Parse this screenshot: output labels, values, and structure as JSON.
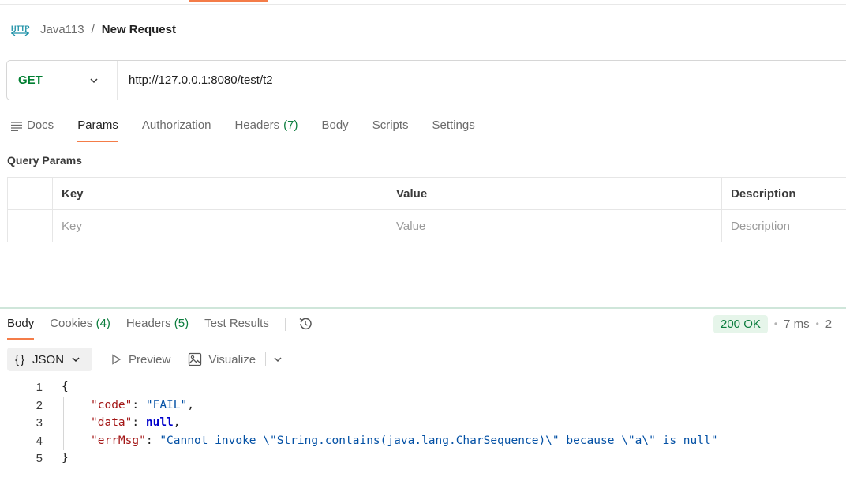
{
  "breadcrumb": {
    "icon": "http-icon",
    "collection": "Java113",
    "separator": "/",
    "title": "New Request"
  },
  "request": {
    "method": "GET",
    "url": "http://127.0.0.1:8080/test/t2"
  },
  "request_tabs": [
    {
      "label": "Docs",
      "count": ""
    },
    {
      "label": "Params",
      "count": ""
    },
    {
      "label": "Authorization",
      "count": ""
    },
    {
      "label": "Headers",
      "count": "(7)"
    },
    {
      "label": "Body",
      "count": ""
    },
    {
      "label": "Scripts",
      "count": ""
    },
    {
      "label": "Settings",
      "count": ""
    }
  ],
  "query_params": {
    "title": "Query Params",
    "columns": [
      "Key",
      "Value",
      "Description"
    ],
    "placeholders": [
      "Key",
      "Value",
      "Description"
    ]
  },
  "response_tabs": [
    {
      "label": "Body",
      "count": ""
    },
    {
      "label": "Cookies",
      "count": "(4)"
    },
    {
      "label": "Headers",
      "count": "(5)"
    },
    {
      "label": "Test Results",
      "count": ""
    }
  ],
  "status": {
    "code": "200 OK",
    "time": "7 ms",
    "size": "2"
  },
  "format_bar": {
    "format": "JSON",
    "preview": "Preview",
    "visualize": "Visualize"
  },
  "code_lines": {
    "l1": "1",
    "l2": "2",
    "l3": "3",
    "l4": "4",
    "l5": "5",
    "open": "{",
    "close": "}",
    "k1": "\"code\"",
    "v1": "\"FAIL\"",
    "k2": "\"data\"",
    "v2": "null",
    "k3": "\"errMsg\"",
    "v3": "\"Cannot invoke \\\"String.contains(java.lang.CharSequence)\\\" because \\\"a\\\" is null\""
  },
  "colors": {
    "accent": "#f47c48",
    "method_get": "#007f31",
    "status_ok_bg": "#e6f5ea",
    "status_ok_text": "#0c7d3e"
  }
}
